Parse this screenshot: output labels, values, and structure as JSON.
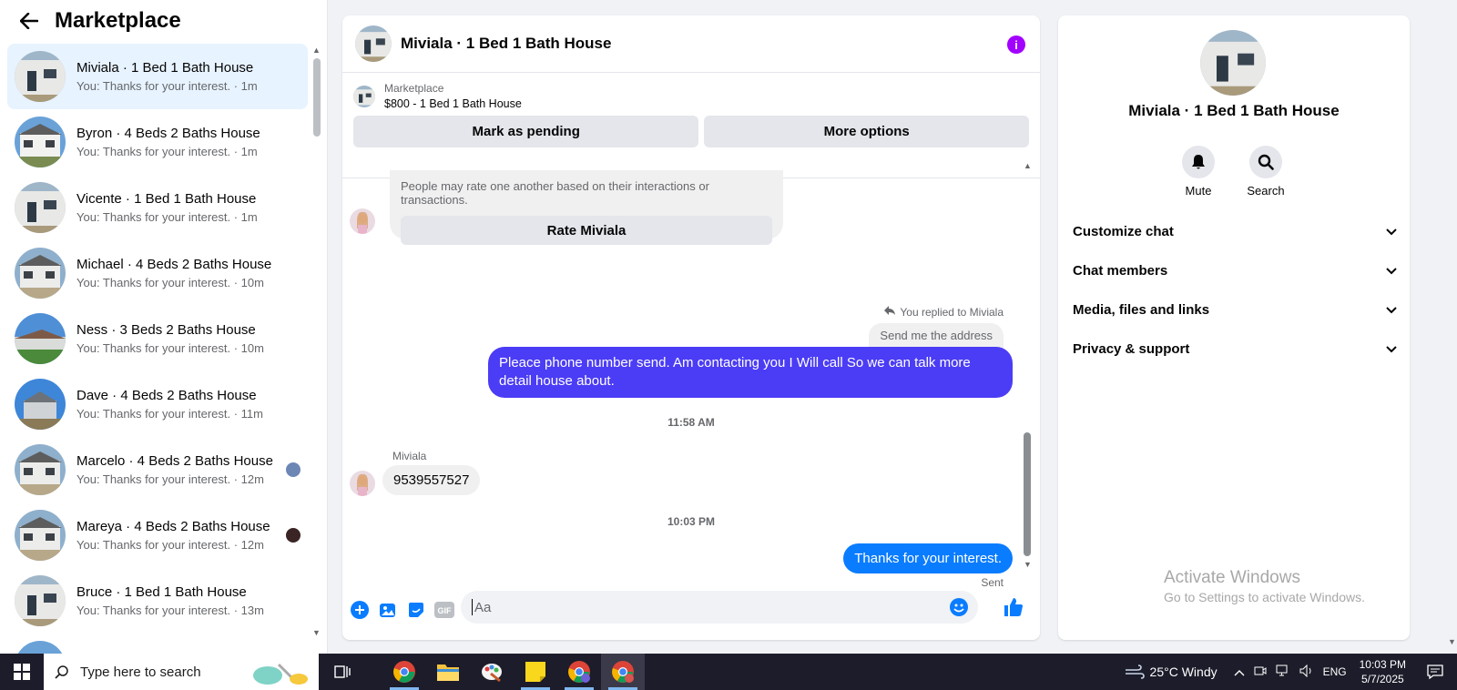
{
  "sidebar": {
    "title": "Marketplace",
    "conversations": [
      {
        "name": "Miviala · 1 Bed 1 Bath House",
        "preview": "You: Thanks for your interest. · 1m",
        "active": true
      },
      {
        "name": "Byron · 4 Beds 2 Baths House",
        "preview": "You: Thanks for your interest. · 1m"
      },
      {
        "name": "Vicente · 1 Bed 1 Bath House",
        "preview": "You: Thanks for your interest. · 1m"
      },
      {
        "name": "Michael · 4 Beds 2 Baths House",
        "preview": "You: Thanks for your interest. · 10m"
      },
      {
        "name": "Ness · 3 Beds 2 Baths House",
        "preview": "You: Thanks for your interest. · 10m"
      },
      {
        "name": "Dave · 4 Beds 2 Baths House",
        "preview": "You: Thanks for your interest. · 11m"
      },
      {
        "name": "Marcelo · 4 Beds 2 Baths House",
        "preview": "You: Thanks for your interest. · 12m"
      },
      {
        "name": "Mareya · 4 Beds 2 Baths House",
        "preview": "You: Thanks for your interest. · 12m"
      },
      {
        "name": "Bruce · 1 Bed 1 Bath House",
        "preview": "You: Thanks for your interest. · 13m"
      }
    ]
  },
  "chat": {
    "title": "Miviala · 1 Bed 1 Bath House",
    "listing": {
      "label": "Marketplace",
      "price_title": "$800 - 1 Bed 1 Bath House",
      "pending_button": "Mark as pending",
      "more_button": "More options"
    },
    "rate": {
      "text": "People may rate one another based on their interactions or transactions.",
      "button": "Rate Miviala"
    },
    "reply_note": "You replied to Miviala",
    "quoted": "Send me the address",
    "outgoing_1": "Pleace phone number send. Am contacting you I Will call So we can talk more detail house about.",
    "time_1": "11:58 AM",
    "sender": "Miviala",
    "incoming_1": "9539557527",
    "time_2": "10:03 PM",
    "outgoing_2": "Thanks for your interest.",
    "status": "Sent",
    "composer_placeholder": "Aa",
    "gif_label": "GIF"
  },
  "info_panel": {
    "title": "Miviala · 1 Bed 1 Bath House",
    "mute_label": "Mute",
    "search_label": "Search",
    "sections": [
      "Customize chat",
      "Chat members",
      "Media, files and links",
      "Privacy & support"
    ]
  },
  "watermark": {
    "line1": "Activate Windows",
    "line2": "Go to Settings to activate Windows."
  },
  "taskbar": {
    "search_placeholder": "Type here to search",
    "weather": "25°C  Windy",
    "lang": "ENG",
    "time": "10:03 PM",
    "date": "5/7/2025"
  },
  "colors": {
    "accent": "#0a7cff",
    "outgoing_bubble": "#4b3cf5",
    "active_row": "#e7f3ff",
    "info_icon": "#a200ff"
  }
}
